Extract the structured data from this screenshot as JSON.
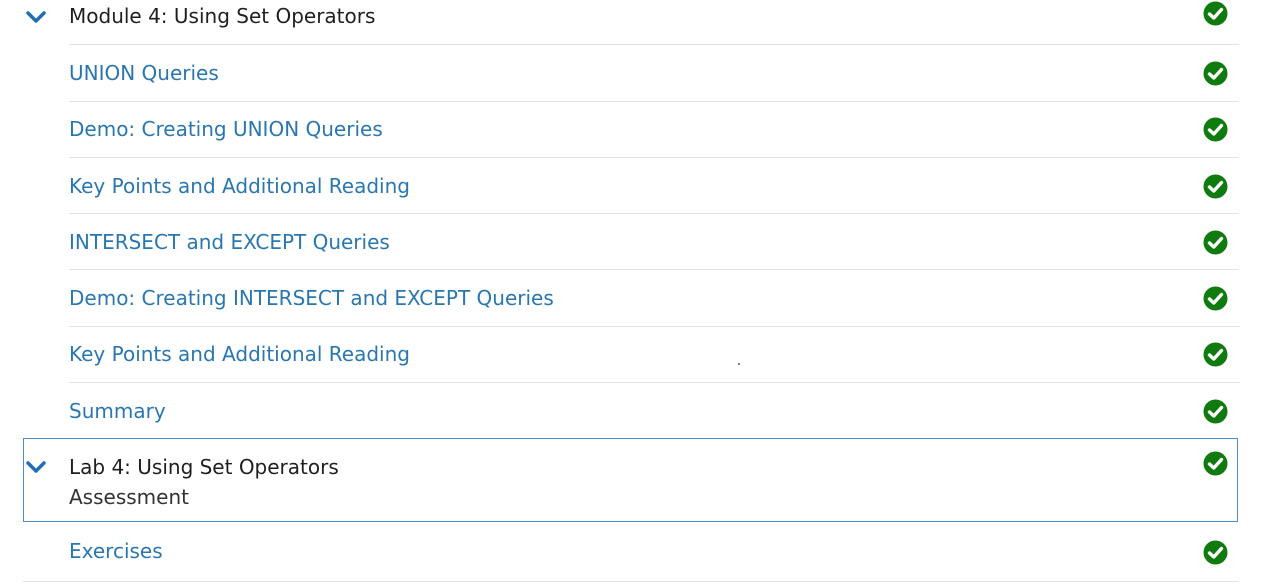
{
  "module": {
    "title": "Module 4: Using Set Operators",
    "expand_icon": "chevron-down-icon",
    "status_icon": "check-circle-icon",
    "items": [
      {
        "label": "UNION Queries",
        "status_icon": "check-circle-icon"
      },
      {
        "label": "Demo: Creating UNION Queries",
        "status_icon": "check-circle-icon"
      },
      {
        "label": "Key Points and Additional Reading",
        "status_icon": "check-circle-icon"
      },
      {
        "label": "INTERSECT and EXCEPT Queries",
        "status_icon": "check-circle-icon"
      },
      {
        "label": "Demo: Creating INTERSECT and EXCEPT Queries",
        "status_icon": "check-circle-icon"
      },
      {
        "label": "Key Points and Additional Reading",
        "status_icon": "check-circle-icon"
      },
      {
        "label": "Summary",
        "status_icon": "check-circle-icon"
      }
    ]
  },
  "lab": {
    "title": "Lab 4: Using Set Operators",
    "subtitle": "Assessment",
    "expand_icon": "chevron-down-icon",
    "status_icon": "check-circle-icon",
    "items": [
      {
        "label": "Exercises",
        "status_icon": "check-circle-icon"
      }
    ]
  },
  "colors": {
    "link": "#2a77b0",
    "chevron": "#1f6fb2",
    "check": "#0f7b0f",
    "divider": "#e2e2e2",
    "lab_border": "#4a8fc9"
  }
}
